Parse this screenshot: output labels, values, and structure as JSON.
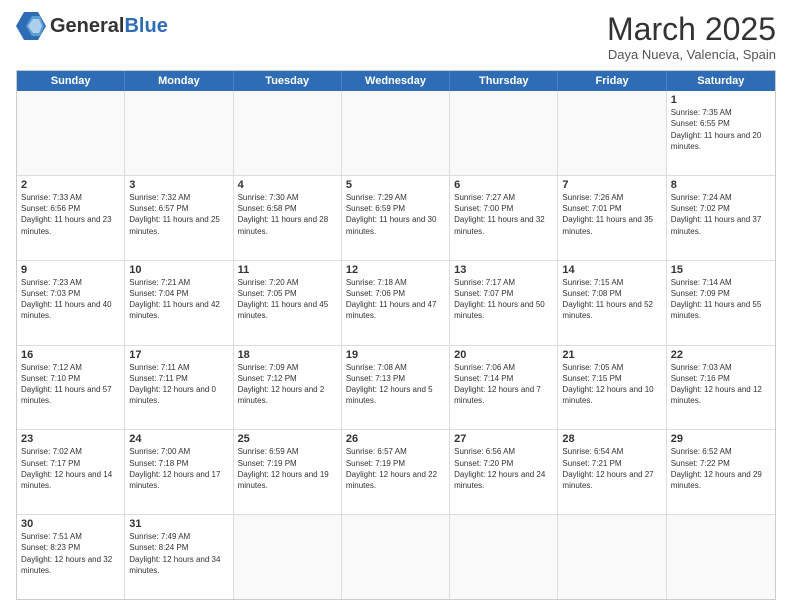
{
  "header": {
    "logo_general": "General",
    "logo_blue": "Blue",
    "month_title": "March 2025",
    "subtitle": "Daya Nueva, Valencia, Spain"
  },
  "weekdays": [
    "Sunday",
    "Monday",
    "Tuesday",
    "Wednesday",
    "Thursday",
    "Friday",
    "Saturday"
  ],
  "rows": [
    [
      {
        "day": "",
        "empty": true
      },
      {
        "day": "",
        "empty": true
      },
      {
        "day": "",
        "empty": true
      },
      {
        "day": "",
        "empty": true
      },
      {
        "day": "",
        "empty": true
      },
      {
        "day": "",
        "empty": true
      },
      {
        "day": "1",
        "sunrise": "7:35 AM",
        "sunset": "6:55 PM",
        "daylight": "11 hours and 20 minutes."
      }
    ],
    [
      {
        "day": "2",
        "sunrise": "7:33 AM",
        "sunset": "6:56 PM",
        "daylight": "11 hours and 23 minutes."
      },
      {
        "day": "3",
        "sunrise": "7:32 AM",
        "sunset": "6:57 PM",
        "daylight": "11 hours and 25 minutes."
      },
      {
        "day": "4",
        "sunrise": "7:30 AM",
        "sunset": "6:58 PM",
        "daylight": "11 hours and 28 minutes."
      },
      {
        "day": "5",
        "sunrise": "7:29 AM",
        "sunset": "6:59 PM",
        "daylight": "11 hours and 30 minutes."
      },
      {
        "day": "6",
        "sunrise": "7:27 AM",
        "sunset": "7:00 PM",
        "daylight": "11 hours and 32 minutes."
      },
      {
        "day": "7",
        "sunrise": "7:26 AM",
        "sunset": "7:01 PM",
        "daylight": "11 hours and 35 minutes."
      },
      {
        "day": "8",
        "sunrise": "7:24 AM",
        "sunset": "7:02 PM",
        "daylight": "11 hours and 37 minutes."
      }
    ],
    [
      {
        "day": "9",
        "sunrise": "7:23 AM",
        "sunset": "7:03 PM",
        "daylight": "11 hours and 40 minutes."
      },
      {
        "day": "10",
        "sunrise": "7:21 AM",
        "sunset": "7:04 PM",
        "daylight": "11 hours and 42 minutes."
      },
      {
        "day": "11",
        "sunrise": "7:20 AM",
        "sunset": "7:05 PM",
        "daylight": "11 hours and 45 minutes."
      },
      {
        "day": "12",
        "sunrise": "7:18 AM",
        "sunset": "7:06 PM",
        "daylight": "11 hours and 47 minutes."
      },
      {
        "day": "13",
        "sunrise": "7:17 AM",
        "sunset": "7:07 PM",
        "daylight": "11 hours and 50 minutes."
      },
      {
        "day": "14",
        "sunrise": "7:15 AM",
        "sunset": "7:08 PM",
        "daylight": "11 hours and 52 minutes."
      },
      {
        "day": "15",
        "sunrise": "7:14 AM",
        "sunset": "7:09 PM",
        "daylight": "11 hours and 55 minutes."
      }
    ],
    [
      {
        "day": "16",
        "sunrise": "7:12 AM",
        "sunset": "7:10 PM",
        "daylight": "11 hours and 57 minutes."
      },
      {
        "day": "17",
        "sunrise": "7:11 AM",
        "sunset": "7:11 PM",
        "daylight": "12 hours and 0 minutes."
      },
      {
        "day": "18",
        "sunrise": "7:09 AM",
        "sunset": "7:12 PM",
        "daylight": "12 hours and 2 minutes."
      },
      {
        "day": "19",
        "sunrise": "7:08 AM",
        "sunset": "7:13 PM",
        "daylight": "12 hours and 5 minutes."
      },
      {
        "day": "20",
        "sunrise": "7:06 AM",
        "sunset": "7:14 PM",
        "daylight": "12 hours and 7 minutes."
      },
      {
        "day": "21",
        "sunrise": "7:05 AM",
        "sunset": "7:15 PM",
        "daylight": "12 hours and 10 minutes."
      },
      {
        "day": "22",
        "sunrise": "7:03 AM",
        "sunset": "7:16 PM",
        "daylight": "12 hours and 12 minutes."
      }
    ],
    [
      {
        "day": "23",
        "sunrise": "7:02 AM",
        "sunset": "7:17 PM",
        "daylight": "12 hours and 14 minutes."
      },
      {
        "day": "24",
        "sunrise": "7:00 AM",
        "sunset": "7:18 PM",
        "daylight": "12 hours and 17 minutes."
      },
      {
        "day": "25",
        "sunrise": "6:59 AM",
        "sunset": "7:19 PM",
        "daylight": "12 hours and 19 minutes."
      },
      {
        "day": "26",
        "sunrise": "6:57 AM",
        "sunset": "7:19 PM",
        "daylight": "12 hours and 22 minutes."
      },
      {
        "day": "27",
        "sunrise": "6:56 AM",
        "sunset": "7:20 PM",
        "daylight": "12 hours and 24 minutes."
      },
      {
        "day": "28",
        "sunrise": "6:54 AM",
        "sunset": "7:21 PM",
        "daylight": "12 hours and 27 minutes."
      },
      {
        "day": "29",
        "sunrise": "6:52 AM",
        "sunset": "7:22 PM",
        "daylight": "12 hours and 29 minutes."
      }
    ],
    [
      {
        "day": "30",
        "sunrise": "7:51 AM",
        "sunset": "8:23 PM",
        "daylight": "12 hours and 32 minutes."
      },
      {
        "day": "31",
        "sunrise": "7:49 AM",
        "sunset": "8:24 PM",
        "daylight": "12 hours and 34 minutes."
      },
      {
        "day": "",
        "empty": true
      },
      {
        "day": "",
        "empty": true
      },
      {
        "day": "",
        "empty": true
      },
      {
        "day": "",
        "empty": true
      },
      {
        "day": "",
        "empty": true
      }
    ]
  ]
}
